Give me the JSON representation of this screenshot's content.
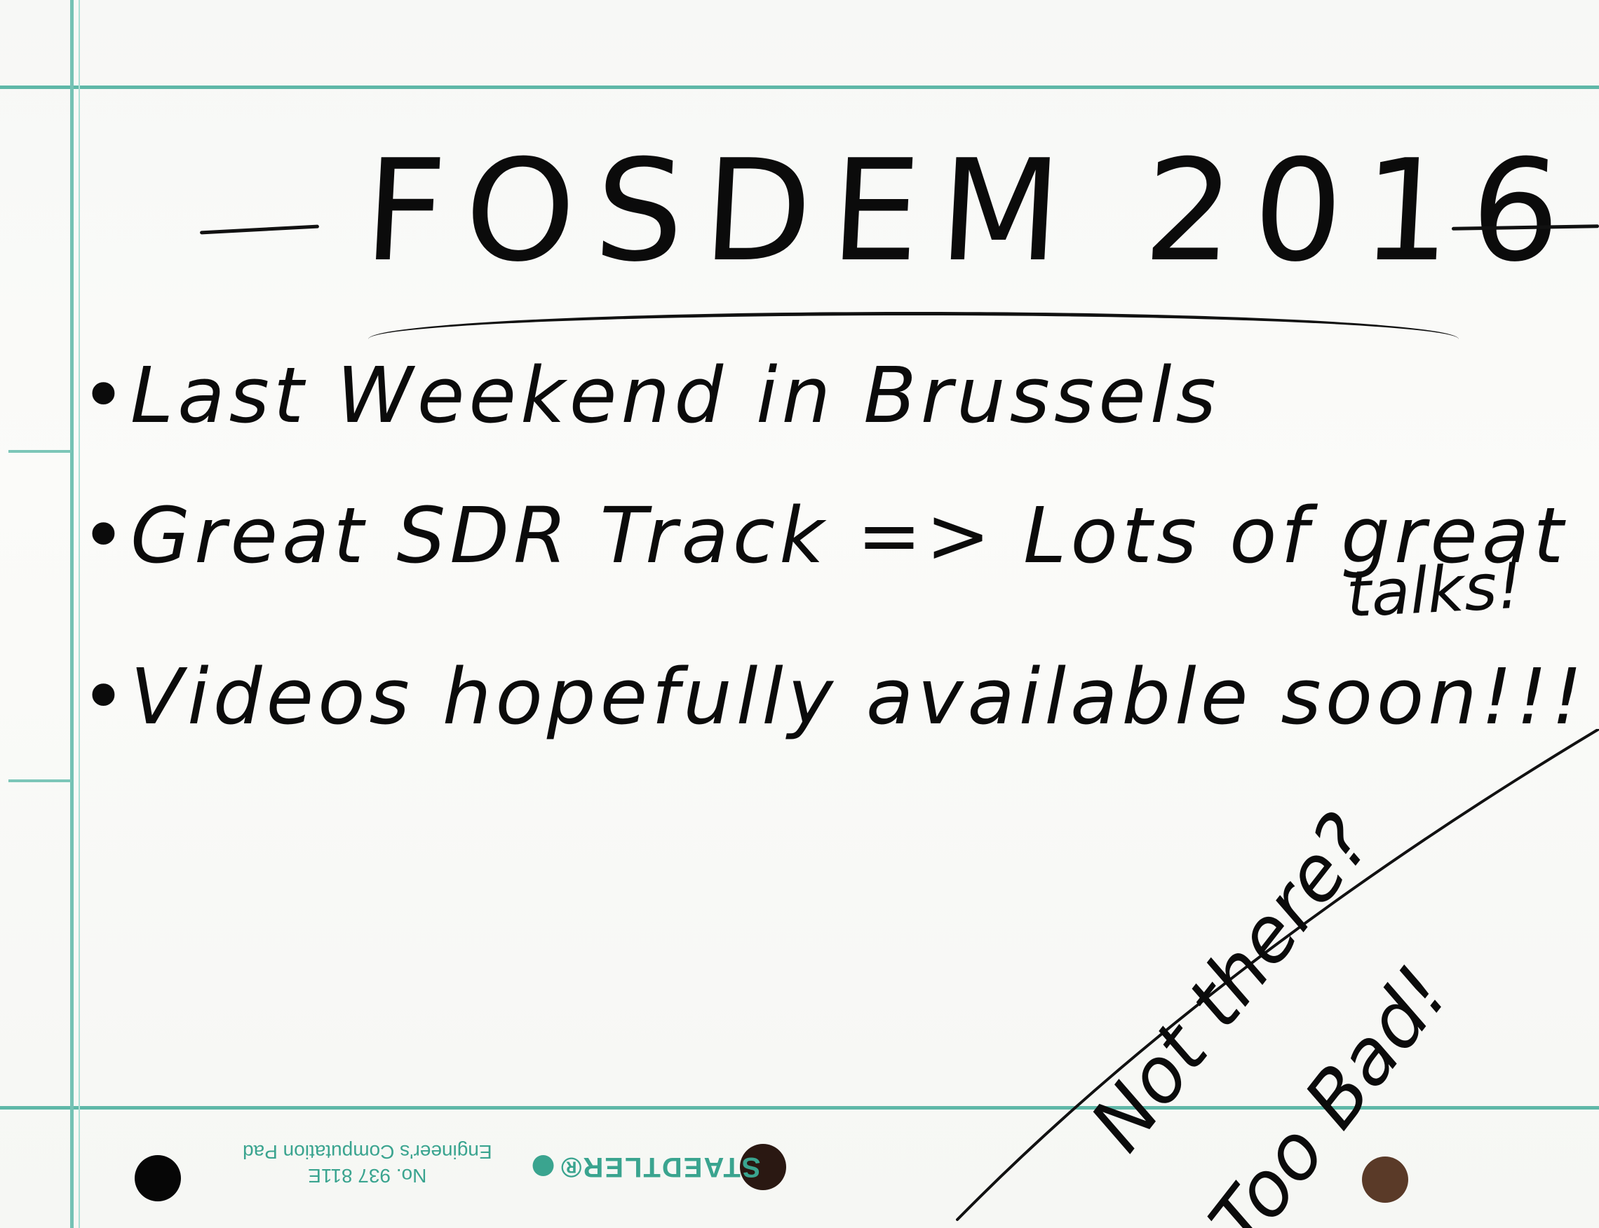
{
  "whiteboard": {
    "title": "FOSDEM 2016",
    "bullets": [
      "•Last Weekend in Brussels",
      "•Great SDR Track => Lots of great",
      "•Videos hopefully available soon!!!"
    ],
    "aside": "talks!",
    "corner_note": {
      "line1": "Not there?",
      "line2": "Too Bad!"
    }
  },
  "pad_print": {
    "brand": "STAEDTLER®",
    "product_line1": "No. 937 811E",
    "product_line2": "Engineer's Computation Pad"
  },
  "colors": {
    "ink": "#0b0b0b",
    "grid": "#5fb8a8",
    "print": "#3aa48f"
  }
}
